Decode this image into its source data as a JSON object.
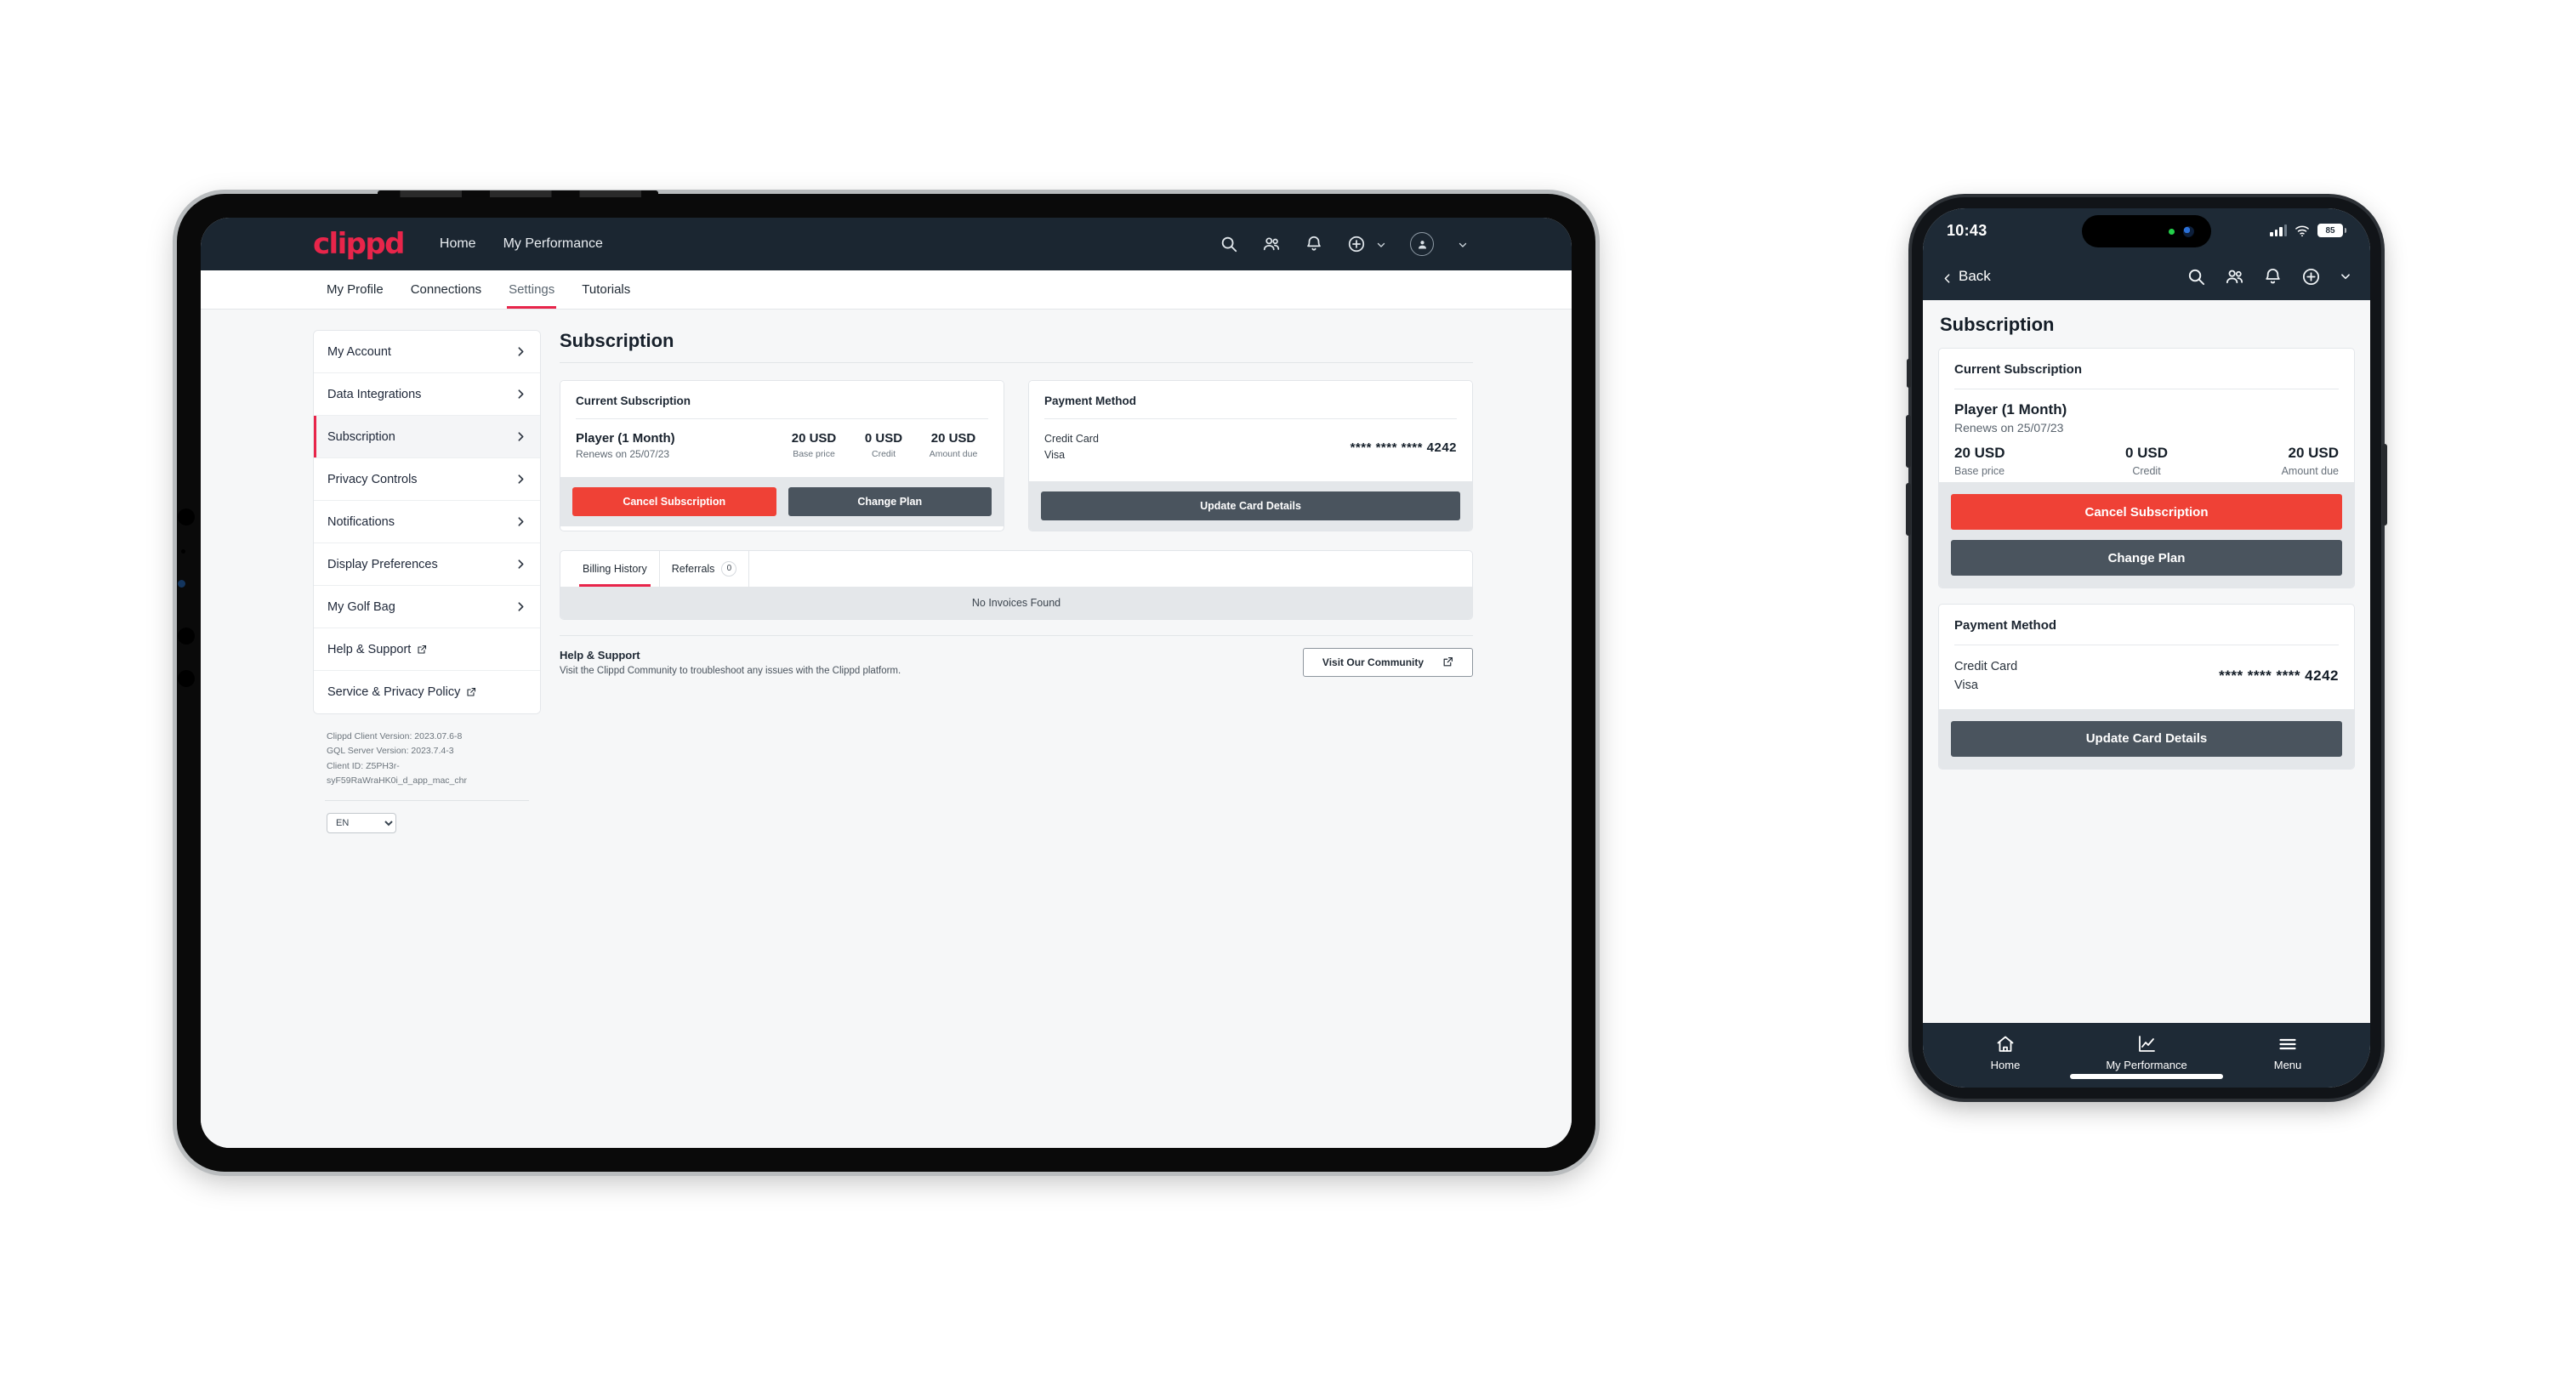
{
  "brand": {
    "name": "clippd"
  },
  "tablet": {
    "topnav": {
      "links": [
        {
          "label": "Home",
          "icon": "home-link"
        },
        {
          "label": "My Performance",
          "icon": "performance-link"
        }
      ],
      "icons": [
        "search-icon",
        "people-icon",
        "bell-icon",
        "plus-circle-icon",
        "avatar-icon"
      ]
    },
    "tabs": [
      {
        "label": "My Profile",
        "active": false
      },
      {
        "label": "Connections",
        "active": false
      },
      {
        "label": "Settings",
        "active": true
      },
      {
        "label": "Tutorials",
        "active": false
      }
    ],
    "sidebar": {
      "items": [
        {
          "label": "My Account",
          "active": false,
          "external": false
        },
        {
          "label": "Data Integrations",
          "active": false,
          "external": false
        },
        {
          "label": "Subscription",
          "active": true,
          "external": false
        },
        {
          "label": "Privacy Controls",
          "active": false,
          "external": false
        },
        {
          "label": "Notifications",
          "active": false,
          "external": false
        },
        {
          "label": "Display Preferences",
          "active": false,
          "external": false
        },
        {
          "label": "My Golf Bag",
          "active": false,
          "external": false
        },
        {
          "label": "Help & Support",
          "active": false,
          "external": true
        },
        {
          "label": "Service & Privacy Policy",
          "active": false,
          "external": true
        }
      ],
      "version": {
        "client": "Clippd Client Version: 2023.07.6-8",
        "server": "GQL Server Version: 2023.7.4-3",
        "client_id": "Client ID: Z5PH3r-syF59RaWraHK0i_d_app_mac_chr"
      },
      "language": {
        "selected": "EN",
        "options": [
          "EN"
        ]
      }
    },
    "page_title": "Subscription",
    "subscription_card": {
      "title": "Current Subscription",
      "plan_name": "Player (1 Month)",
      "renews": "Renews on 25/07/23",
      "amounts": [
        {
          "value": "20 USD",
          "label": "Base price"
        },
        {
          "value": "0 USD",
          "label": "Credit"
        },
        {
          "value": "20 USD",
          "label": "Amount due"
        }
      ],
      "cancel_label": "Cancel Subscription",
      "change_label": "Change Plan"
    },
    "payment_card": {
      "title": "Payment Method",
      "type": "Credit Card",
      "network": "Visa",
      "mask": "**** **** **** 4242",
      "update_label": "Update Card Details"
    },
    "history": {
      "tabs": [
        {
          "label": "Billing History",
          "count": null,
          "active": true
        },
        {
          "label": "Referrals",
          "count": "0",
          "active": false
        }
      ],
      "empty_text": "No Invoices Found"
    },
    "help": {
      "title": "Help & Support",
      "text": "Visit the Clippd Community to troubleshoot any issues with the Clippd platform.",
      "button_label": "Visit Our Community"
    }
  },
  "phone": {
    "status": {
      "time": "10:43",
      "battery": "85"
    },
    "navbar": {
      "back_label": "Back",
      "icons": [
        "search-icon",
        "people-icon",
        "bell-icon",
        "plus-circle-icon"
      ]
    },
    "page_title": "Subscription",
    "subscription_card": {
      "title": "Current Subscription",
      "plan_name": "Player (1 Month)",
      "renews": "Renews on 25/07/23",
      "amounts": [
        {
          "value": "20 USD",
          "label": "Base price"
        },
        {
          "value": "0 USD",
          "label": "Credit"
        },
        {
          "value": "20 USD",
          "label": "Amount due"
        }
      ],
      "cancel_label": "Cancel Subscription",
      "change_label": "Change Plan"
    },
    "payment_card": {
      "title": "Payment Method",
      "type": "Credit Card",
      "network": "Visa",
      "mask": "**** **** **** 4242",
      "update_label": "Update Card Details"
    },
    "tabbar": [
      {
        "label": "Home",
        "icon": "home-icon"
      },
      {
        "label": "My Performance",
        "icon": "chart-icon"
      },
      {
        "label": "Menu",
        "icon": "hamburger-icon"
      }
    ]
  },
  "colors": {
    "brand_red": "#e8254a",
    "danger": "#ef4136",
    "dark_button": "#4a545e",
    "header_dark": "#1b2631"
  }
}
